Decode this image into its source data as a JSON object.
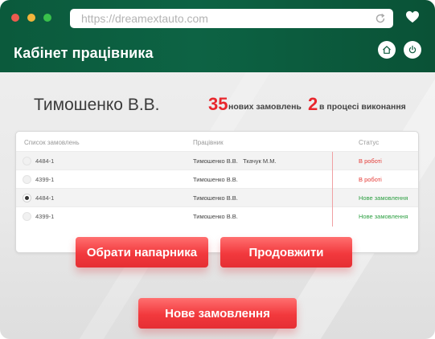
{
  "browser": {
    "url": "https://dreamextauto.com"
  },
  "header": {
    "title": "Кабінет працівника"
  },
  "user": {
    "name": "Тимошенко В.В."
  },
  "stats": {
    "new_orders_count": "35",
    "new_orders_label": "нових замовлень",
    "in_progress_count": "2",
    "in_progress_label": "в процесі виконання"
  },
  "table": {
    "headers": [
      "Список замовлень",
      "Працівник",
      "Статус"
    ],
    "rows": [
      {
        "id": "4484-1",
        "worker": "Тимошенко В.В.   Ткачук М.М.",
        "status": "В роботі",
        "selected": false
      },
      {
        "id": "4399-1",
        "worker": "Тимошенко В.В.",
        "status": "В роботі",
        "selected": false
      },
      {
        "id": "4484-1",
        "worker": "Тимошенко В.В.",
        "status": "Нове замовлення",
        "selected": true
      },
      {
        "id": "4399-1",
        "worker": "Тимошенко В.В.",
        "status": "Нове замовлення",
        "selected": false
      }
    ]
  },
  "buttons": {
    "choose_partner": "Обрати напарника",
    "continue": "Продовжити",
    "new_order": "Нове замовлення"
  },
  "colors": {
    "header_green": "#0b5a3c",
    "accent_red": "#e8262c",
    "status_in_work": "#e53935",
    "status_new": "#2ea043"
  },
  "icons": [
    "reload-icon",
    "heart-icon",
    "home-icon",
    "power-icon"
  ]
}
